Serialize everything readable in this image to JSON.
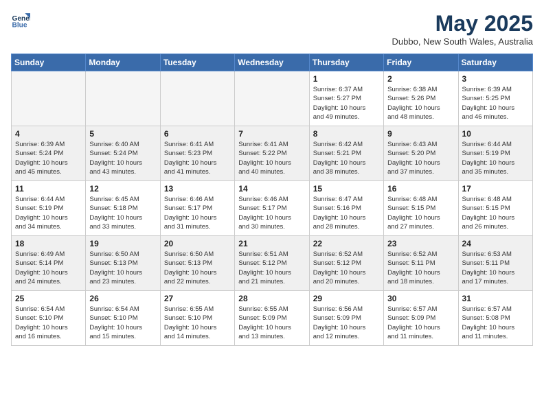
{
  "header": {
    "logo_line1": "General",
    "logo_line2": "Blue",
    "month_year": "May 2025",
    "location": "Dubbo, New South Wales, Australia"
  },
  "weekdays": [
    "Sunday",
    "Monday",
    "Tuesday",
    "Wednesday",
    "Thursday",
    "Friday",
    "Saturday"
  ],
  "weeks": [
    [
      {
        "day": "",
        "info": ""
      },
      {
        "day": "",
        "info": ""
      },
      {
        "day": "",
        "info": ""
      },
      {
        "day": "",
        "info": ""
      },
      {
        "day": "1",
        "info": "Sunrise: 6:37 AM\nSunset: 5:27 PM\nDaylight: 10 hours\nand 49 minutes."
      },
      {
        "day": "2",
        "info": "Sunrise: 6:38 AM\nSunset: 5:26 PM\nDaylight: 10 hours\nand 48 minutes."
      },
      {
        "day": "3",
        "info": "Sunrise: 6:39 AM\nSunset: 5:25 PM\nDaylight: 10 hours\nand 46 minutes."
      }
    ],
    [
      {
        "day": "4",
        "info": "Sunrise: 6:39 AM\nSunset: 5:24 PM\nDaylight: 10 hours\nand 45 minutes."
      },
      {
        "day": "5",
        "info": "Sunrise: 6:40 AM\nSunset: 5:24 PM\nDaylight: 10 hours\nand 43 minutes."
      },
      {
        "day": "6",
        "info": "Sunrise: 6:41 AM\nSunset: 5:23 PM\nDaylight: 10 hours\nand 41 minutes."
      },
      {
        "day": "7",
        "info": "Sunrise: 6:41 AM\nSunset: 5:22 PM\nDaylight: 10 hours\nand 40 minutes."
      },
      {
        "day": "8",
        "info": "Sunrise: 6:42 AM\nSunset: 5:21 PM\nDaylight: 10 hours\nand 38 minutes."
      },
      {
        "day": "9",
        "info": "Sunrise: 6:43 AM\nSunset: 5:20 PM\nDaylight: 10 hours\nand 37 minutes."
      },
      {
        "day": "10",
        "info": "Sunrise: 6:44 AM\nSunset: 5:19 PM\nDaylight: 10 hours\nand 35 minutes."
      }
    ],
    [
      {
        "day": "11",
        "info": "Sunrise: 6:44 AM\nSunset: 5:19 PM\nDaylight: 10 hours\nand 34 minutes."
      },
      {
        "day": "12",
        "info": "Sunrise: 6:45 AM\nSunset: 5:18 PM\nDaylight: 10 hours\nand 33 minutes."
      },
      {
        "day": "13",
        "info": "Sunrise: 6:46 AM\nSunset: 5:17 PM\nDaylight: 10 hours\nand 31 minutes."
      },
      {
        "day": "14",
        "info": "Sunrise: 6:46 AM\nSunset: 5:17 PM\nDaylight: 10 hours\nand 30 minutes."
      },
      {
        "day": "15",
        "info": "Sunrise: 6:47 AM\nSunset: 5:16 PM\nDaylight: 10 hours\nand 28 minutes."
      },
      {
        "day": "16",
        "info": "Sunrise: 6:48 AM\nSunset: 5:15 PM\nDaylight: 10 hours\nand 27 minutes."
      },
      {
        "day": "17",
        "info": "Sunrise: 6:48 AM\nSunset: 5:15 PM\nDaylight: 10 hours\nand 26 minutes."
      }
    ],
    [
      {
        "day": "18",
        "info": "Sunrise: 6:49 AM\nSunset: 5:14 PM\nDaylight: 10 hours\nand 24 minutes."
      },
      {
        "day": "19",
        "info": "Sunrise: 6:50 AM\nSunset: 5:13 PM\nDaylight: 10 hours\nand 23 minutes."
      },
      {
        "day": "20",
        "info": "Sunrise: 6:50 AM\nSunset: 5:13 PM\nDaylight: 10 hours\nand 22 minutes."
      },
      {
        "day": "21",
        "info": "Sunrise: 6:51 AM\nSunset: 5:12 PM\nDaylight: 10 hours\nand 21 minutes."
      },
      {
        "day": "22",
        "info": "Sunrise: 6:52 AM\nSunset: 5:12 PM\nDaylight: 10 hours\nand 20 minutes."
      },
      {
        "day": "23",
        "info": "Sunrise: 6:52 AM\nSunset: 5:11 PM\nDaylight: 10 hours\nand 18 minutes."
      },
      {
        "day": "24",
        "info": "Sunrise: 6:53 AM\nSunset: 5:11 PM\nDaylight: 10 hours\nand 17 minutes."
      }
    ],
    [
      {
        "day": "25",
        "info": "Sunrise: 6:54 AM\nSunset: 5:10 PM\nDaylight: 10 hours\nand 16 minutes."
      },
      {
        "day": "26",
        "info": "Sunrise: 6:54 AM\nSunset: 5:10 PM\nDaylight: 10 hours\nand 15 minutes."
      },
      {
        "day": "27",
        "info": "Sunrise: 6:55 AM\nSunset: 5:10 PM\nDaylight: 10 hours\nand 14 minutes."
      },
      {
        "day": "28",
        "info": "Sunrise: 6:55 AM\nSunset: 5:09 PM\nDaylight: 10 hours\nand 13 minutes."
      },
      {
        "day": "29",
        "info": "Sunrise: 6:56 AM\nSunset: 5:09 PM\nDaylight: 10 hours\nand 12 minutes."
      },
      {
        "day": "30",
        "info": "Sunrise: 6:57 AM\nSunset: 5:09 PM\nDaylight: 10 hours\nand 11 minutes."
      },
      {
        "day": "31",
        "info": "Sunrise: 6:57 AM\nSunset: 5:08 PM\nDaylight: 10 hours\nand 11 minutes."
      }
    ]
  ]
}
